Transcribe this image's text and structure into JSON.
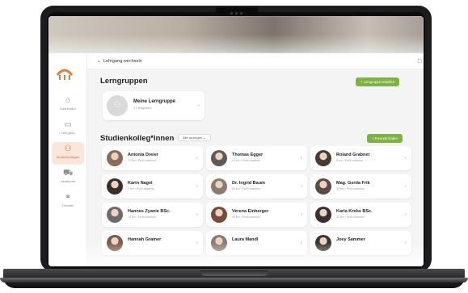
{
  "topbar": {
    "switch_label": "Lehrgang wechseln"
  },
  "sidebar": {
    "items": [
      {
        "label": "Dashboard"
      },
      {
        "label": "Lehrgang"
      },
      {
        "label": "Studienkollegen"
      },
      {
        "label": "Akademie"
      },
      {
        "label": "Freunde"
      }
    ]
  },
  "groups": {
    "title": "Lerngruppen",
    "create_button": "+ Lerngruppe erstellen",
    "card": {
      "name": "Meine Lerngruppe",
      "sub": "21 Mitglieder"
    }
  },
  "classmates": {
    "title": "Studienkolleg*innen",
    "filter": "Alle anzeigen",
    "find_button": "+ Freunde finden",
    "people": [
      {
        "name": "Antonia Dreier",
        "sub": "12 km • Profil ansehen",
        "color": "#8a6a58"
      },
      {
        "name": "Thomas Egger",
        "sub": "22 km • Profil ansehen",
        "color": "#5f5a55"
      },
      {
        "name": "Roland Grabner",
        "sub": "8 km • Profil ansehen",
        "color": "#4a3b30"
      },
      {
        "name": "Karin Nagel",
        "sub": "2 km • Profil ansehen",
        "color": "#3b2e28"
      },
      {
        "name": "Dr. Ingrid Baum",
        "sub": "60 km • Profil ansehen",
        "color": "#8e7b6f"
      },
      {
        "name": "Mag. Gerda Frik",
        "sub": "30 km • Profil ansehen",
        "color": "#5d4b43"
      },
      {
        "name": "Hannes Zyanie BSc.",
        "sub": "12 km • Profil ansehen",
        "color": "#6f6a66"
      },
      {
        "name": "Verena Einberger",
        "sub": "40 km • Profil ansehen",
        "color": "#7a4a3a"
      },
      {
        "name": "Karla Krebs BSc.",
        "sub": "22 km • Profil ansehen",
        "color": "#3a2f2b"
      },
      {
        "name": "Hannah Gramer",
        "sub": "",
        "color": "#7b5a4a"
      },
      {
        "name": "Laura Mandl",
        "sub": "",
        "color": "#8c7a72"
      },
      {
        "name": "Joey Sammer",
        "sub": "",
        "color": "#3b342f"
      }
    ]
  }
}
